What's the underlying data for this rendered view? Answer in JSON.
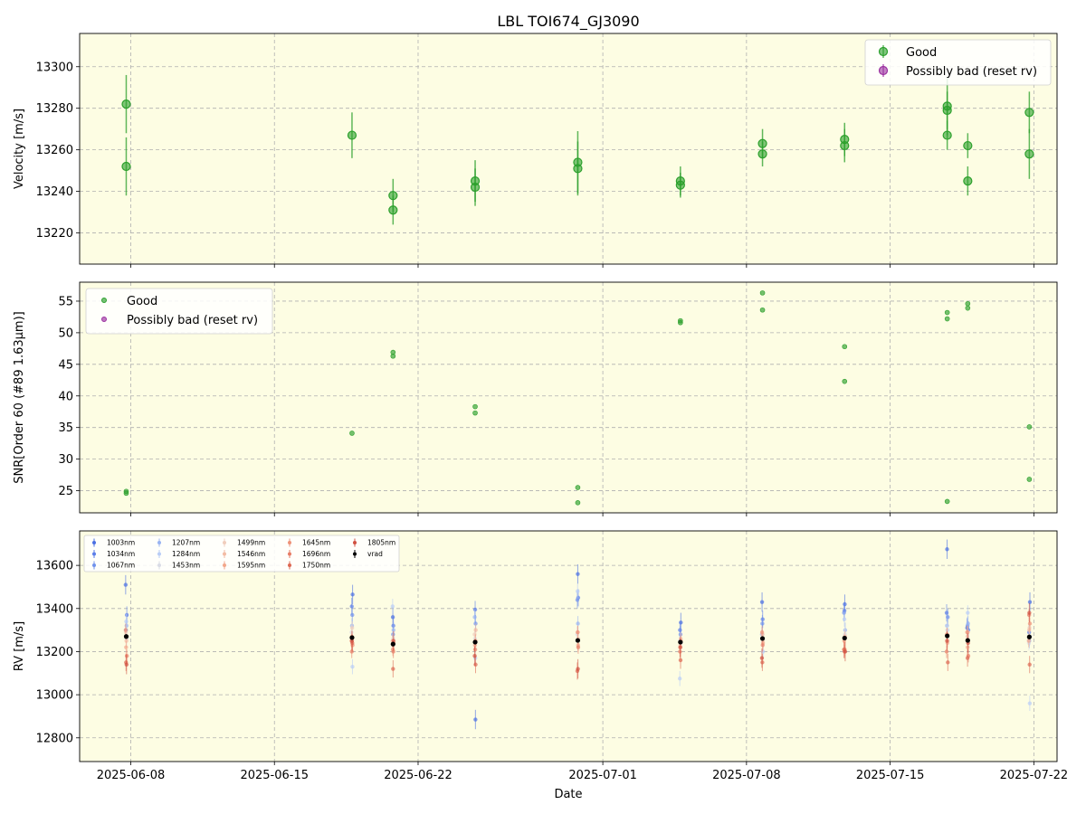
{
  "figure": {
    "title": "LBL TOI674_GJ3090",
    "xlabel": "Date",
    "background_color": "#fdfde3",
    "good_color": "#2ca02c",
    "bad_color": "#9b30a0"
  },
  "x_ticks": [
    "2025-06-08",
    "2025-06-15",
    "2025-06-22",
    "2025-07-01",
    "2025-07-08",
    "2025-07-15",
    "2025-07-22"
  ],
  "chart_data": [
    {
      "type": "scatter",
      "name": "velocity",
      "ylabel": "Velocity [m/s]",
      "x_range": [
        "2025-06-05",
        "2025-07-22"
      ],
      "ylim": [
        13205,
        13316
      ],
      "y_ticks": [
        13220,
        13240,
        13260,
        13280,
        13300
      ],
      "grid": true,
      "legend_placement": "upper-right",
      "series": [
        {
          "name": "Good",
          "color": "#2ca02c",
          "points": [
            {
              "x": "2025-06-07",
              "y": 13282,
              "err": 14
            },
            {
              "x": "2025-06-07",
              "y": 13252,
              "err": 14
            },
            {
              "x": "2025-06-18",
              "y": 13267,
              "err": 11
            },
            {
              "x": "2025-06-20",
              "y": 13238,
              "err": 8
            },
            {
              "x": "2025-06-20",
              "y": 13231,
              "err": 7
            },
            {
              "x": "2025-06-24",
              "y": 13245,
              "err": 10
            },
            {
              "x": "2025-06-24",
              "y": 13242,
              "err": 9
            },
            {
              "x": "2025-06-29",
              "y": 13254,
              "err": 15
            },
            {
              "x": "2025-06-29",
              "y": 13251,
              "err": 13
            },
            {
              "x": "2025-07-04",
              "y": 13245,
              "err": 7
            },
            {
              "x": "2025-07-04",
              "y": 13243,
              "err": 6
            },
            {
              "x": "2025-07-08",
              "y": 13263,
              "err": 7
            },
            {
              "x": "2025-07-08",
              "y": 13258,
              "err": 6
            },
            {
              "x": "2025-07-12",
              "y": 13265,
              "err": 8
            },
            {
              "x": "2025-07-12",
              "y": 13262,
              "err": 8
            },
            {
              "x": "2025-07-17",
              "y": 13281,
              "err": 14
            },
            {
              "x": "2025-07-17",
              "y": 13279,
              "err": 9
            },
            {
              "x": "2025-07-17",
              "y": 13267,
              "err": 7
            },
            {
              "x": "2025-07-18",
              "y": 13262,
              "err": 6
            },
            {
              "x": "2025-07-18",
              "y": 13245,
              "err": 7
            },
            {
              "x": "2025-07-21",
              "y": 13278,
              "err": 10
            },
            {
              "x": "2025-07-21",
              "y": 13258,
              "err": 12
            }
          ]
        },
        {
          "name": "Possibly bad (reset rv)",
          "color": "#9b30a0",
          "points": []
        }
      ]
    },
    {
      "type": "scatter",
      "name": "snr",
      "ylabel": "SNR[Order 60 (#89 1.63μm)]",
      "x_range": [
        "2025-06-05",
        "2025-07-22"
      ],
      "ylim": [
        21.5,
        58
      ],
      "y_ticks": [
        25,
        30,
        35,
        40,
        45,
        50,
        55
      ],
      "grid": true,
      "legend_placement": "upper-left",
      "series": [
        {
          "name": "Good",
          "color": "#2ca02c",
          "points": [
            {
              "x": "2025-06-07",
              "y": 24.9
            },
            {
              "x": "2025-06-07",
              "y": 24.6
            },
            {
              "x": "2025-06-18",
              "y": 34.1
            },
            {
              "x": "2025-06-20",
              "y": 46.9
            },
            {
              "x": "2025-06-20",
              "y": 46.3
            },
            {
              "x": "2025-06-24",
              "y": 38.3
            },
            {
              "x": "2025-06-24",
              "y": 37.3
            },
            {
              "x": "2025-06-29",
              "y": 25.5
            },
            {
              "x": "2025-06-29",
              "y": 23.1
            },
            {
              "x": "2025-07-04",
              "y": 51.9
            },
            {
              "x": "2025-07-04",
              "y": 51.6
            },
            {
              "x": "2025-07-08",
              "y": 56.3
            },
            {
              "x": "2025-07-08",
              "y": 53.6
            },
            {
              "x": "2025-07-12",
              "y": 47.8
            },
            {
              "x": "2025-07-12",
              "y": 42.3
            },
            {
              "x": "2025-07-17",
              "y": 53.2
            },
            {
              "x": "2025-07-17",
              "y": 52.2
            },
            {
              "x": "2025-07-17",
              "y": 23.3
            },
            {
              "x": "2025-07-18",
              "y": 54.6
            },
            {
              "x": "2025-07-18",
              "y": 53.9
            },
            {
              "x": "2025-07-21",
              "y": 35.1
            },
            {
              "x": "2025-07-21",
              "y": 26.8
            }
          ]
        },
        {
          "name": "Possibly bad (reset rv)",
          "color": "#9b30a0",
          "points": []
        }
      ]
    },
    {
      "type": "scatter",
      "name": "rv",
      "ylabel": "RV [m/s]",
      "x_range": [
        "2025-06-05",
        "2025-07-22"
      ],
      "ylim": [
        12690,
        13760
      ],
      "y_ticks": [
        12800,
        13000,
        13200,
        13400,
        13600
      ],
      "grid": true,
      "legend_placement": "upper-left",
      "epoch_dates": [
        "2025-06-07",
        "2025-06-18",
        "2025-06-20",
        "2025-06-24",
        "2025-06-29",
        "2025-07-04",
        "2025-07-08",
        "2025-07-12",
        "2025-07-17",
        "2025-07-18",
        "2025-07-21"
      ],
      "series": [
        {
          "name": "1003nm",
          "color": "#4a6fe3",
          "err": 45,
          "values": [
            13510,
            13465,
            13360,
            12885,
            13560,
            13335,
            13430,
            13420,
            13675,
            13310,
            13430
          ]
        },
        {
          "name": "1034nm",
          "color": "#5b7ee8",
          "err": 40,
          "values": [
            13370,
            13410,
            13320,
            13395,
            13450,
            13300,
            13350,
            13390,
            13380,
            13300,
            13290
          ]
        },
        {
          "name": "1067nm",
          "color": "#7092ec",
          "err": 40,
          "values": [
            13300,
            13370,
            13280,
            13330,
            13440,
            13280,
            13330,
            13380,
            13360,
            13320,
            13270
          ]
        },
        {
          "name": "1207nm",
          "color": "#98b3f2",
          "err": 35,
          "values": [
            13320,
            13320,
            13300,
            13360,
            13330,
            13250,
            13280,
            13300,
            13320,
            13330,
            13250
          ]
        },
        {
          "name": "1284nm",
          "color": "#b9cdf6",
          "err": 35,
          "values": [
            13340,
            13130,
            13410,
            13170,
            13480,
            13075,
            13200,
            13350,
            13300,
            13380,
            12960
          ]
        },
        {
          "name": "1453nm",
          "color": "#d9dce6",
          "err": 35,
          "values": [
            13260,
            13290,
            13260,
            13260,
            13280,
            13240,
            13260,
            13280,
            13300,
            13250,
            13240
          ]
        },
        {
          "name": "1499nm",
          "color": "#f0cdbc",
          "err": 30,
          "values": [
            13290,
            13310,
            13230,
            13280,
            13260,
            13230,
            13250,
            13260,
            13250,
            13270,
            13310
          ]
        },
        {
          "name": "1546nm",
          "color": "#f3bba4",
          "err": 30,
          "values": [
            13250,
            13270,
            13250,
            13300,
            13290,
            13260,
            13280,
            13270,
            13280,
            13290,
            13300
          ]
        },
        {
          "name": "1595nm",
          "color": "#f2a68b",
          "err": 30,
          "values": [
            13220,
            13250,
            13240,
            13230,
            13230,
            13220,
            13240,
            13250,
            13240,
            13220,
            13250
          ]
        },
        {
          "name": "1645nm",
          "color": "#ee9278",
          "err": 30,
          "values": [
            13300,
            13230,
            13210,
            13250,
            13290,
            13250,
            13290,
            13210,
            13280,
            13290,
            13330
          ]
        },
        {
          "name": "1696nm",
          "color": "#e77d66",
          "err": 30,
          "values": [
            13180,
            13200,
            13200,
            13210,
            13220,
            13200,
            13230,
            13200,
            13200,
            13180,
            13370
          ]
        },
        {
          "name": "1750nm",
          "color": "#dd6852",
          "err": 40,
          "values": [
            13150,
            13240,
            13120,
            13140,
            13110,
            13160,
            13150,
            13210,
            13150,
            13170,
            13140
          ]
        },
        {
          "name": "1805nm",
          "color": "#d05040",
          "err": 45,
          "values": [
            13140,
            13250,
            13250,
            13180,
            13120,
            13220,
            13170,
            13200,
            13250,
            13240,
            13380
          ]
        },
        {
          "name": "vrad",
          "color": "#000000",
          "err": 10,
          "values": [
            13270,
            13265,
            13235,
            13244,
            13252,
            13244,
            13261,
            13263,
            13273,
            13252,
            13268
          ]
        }
      ]
    }
  ]
}
